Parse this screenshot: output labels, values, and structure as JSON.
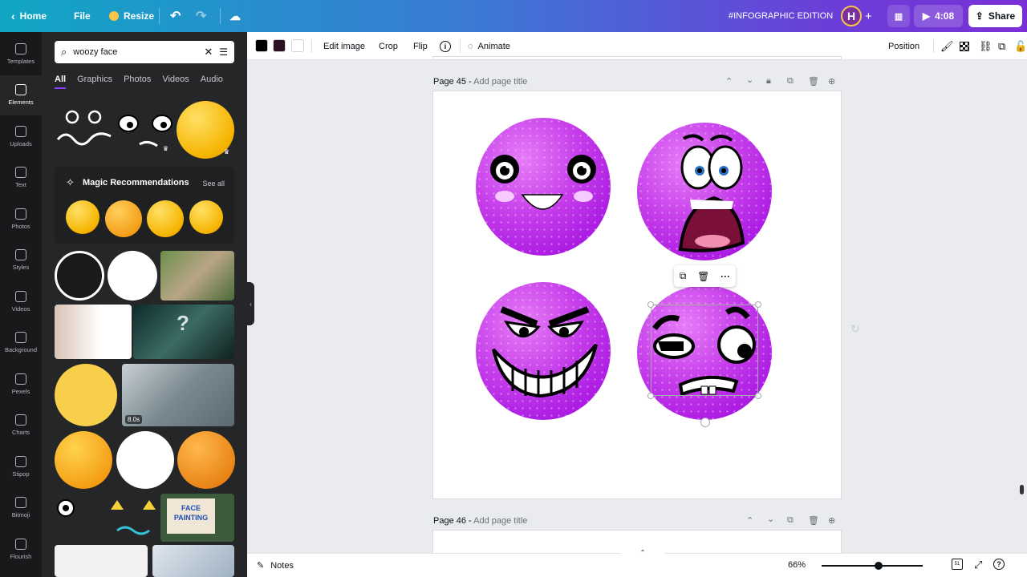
{
  "topbar": {
    "home_label": "Home",
    "file_label": "File",
    "resize_label": "Resize",
    "edition_label": "#INFOGRAPHIC EDITION",
    "avatar_initial": "H",
    "add_label": "+",
    "play_time": "4:08",
    "share_label": "Share"
  },
  "rail": {
    "items": [
      {
        "label": "Templates",
        "icon": "templates-icon"
      },
      {
        "label": "Elements",
        "icon": "elements-icon",
        "active": true
      },
      {
        "label": "Uploads",
        "icon": "uploads-icon"
      },
      {
        "label": "Text",
        "icon": "text-icon"
      },
      {
        "label": "Photos",
        "icon": "photos-icon"
      },
      {
        "label": "Styles",
        "icon": "styles-icon"
      },
      {
        "label": "Videos",
        "icon": "videos-icon"
      },
      {
        "label": "Background",
        "icon": "background-icon"
      },
      {
        "label": "Pexels",
        "icon": "pexels-icon"
      },
      {
        "label": "Charts",
        "icon": "charts-icon"
      },
      {
        "label": "Stipop",
        "icon": "stipop-icon"
      },
      {
        "label": "Bitmoji",
        "icon": "bitmoji-icon"
      },
      {
        "label": "Flourish",
        "icon": "flourish-icon"
      }
    ]
  },
  "panel": {
    "search_value": "woozy face",
    "tabs": [
      "All",
      "Graphics",
      "Photos",
      "Videos",
      "Audio"
    ],
    "magic_title": "Magic Recommendations",
    "magic_see_all": "See all",
    "video_duration": "8.0s",
    "sign_text": "FACE PAINTING"
  },
  "toolbar": {
    "colors": [
      "#000000",
      "#2a1020",
      "#ffffff"
    ],
    "edit_image": "Edit image",
    "crop": "Crop",
    "flip": "Flip",
    "info": "i",
    "animate": "Animate",
    "position": "Position"
  },
  "canvas": {
    "page45_label": "Page 45 -",
    "page45_title_placeholder": "Add page title",
    "page46_label": "Page 46 -",
    "page46_title_placeholder": "Add page title",
    "face_color": "#b21fe6"
  },
  "bottombar": {
    "notes_label": "Notes",
    "zoom_label": "66%",
    "zoom_percent": 66,
    "page_count": "51"
  }
}
